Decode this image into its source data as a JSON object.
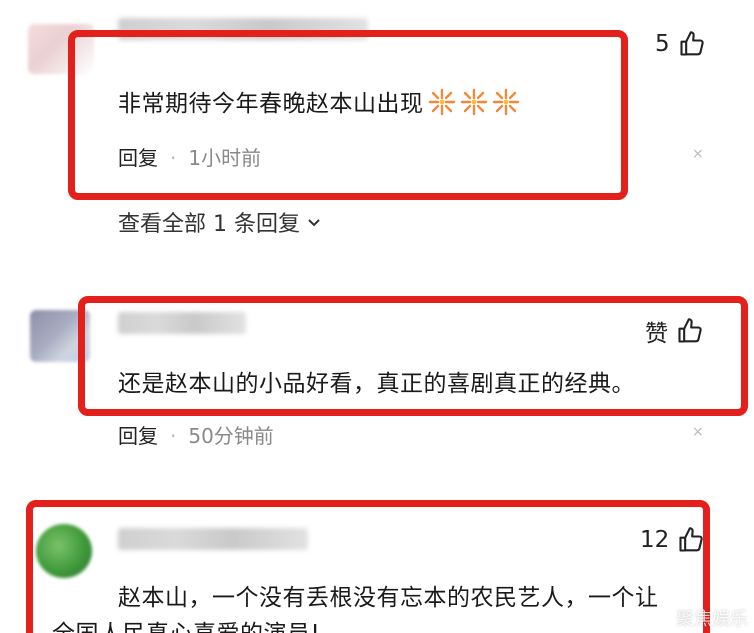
{
  "comments": [
    {
      "text": "非常期待今年春晚赵本山出现",
      "emoji_count": 3,
      "emoji_name": "firework-emoji",
      "likes": "5",
      "reply_label": "回复",
      "separator": "·",
      "time": "1小时前",
      "view_replies": "查看全部 1 条回复",
      "close": "×"
    },
    {
      "text": "还是赵本山的小品好看，真正的喜剧真正的经典。",
      "likes": "赞",
      "reply_label": "回复",
      "separator": "·",
      "time": "50分钟前",
      "close": "×"
    },
    {
      "text_line1": "赵本山，一个没有丢根没有忘本的农民艺人，一个让",
      "text_line2": "全国人民真心喜爱的演员!",
      "likes": "12"
    }
  ],
  "watermark": "聚焦娱乐",
  "colors": {
    "highlight": "#e3201b",
    "time": "#8a8a8a"
  },
  "icons": [
    "thumbs-up-icon",
    "close-icon",
    "chevron-down-icon",
    "firework-emoji"
  ]
}
